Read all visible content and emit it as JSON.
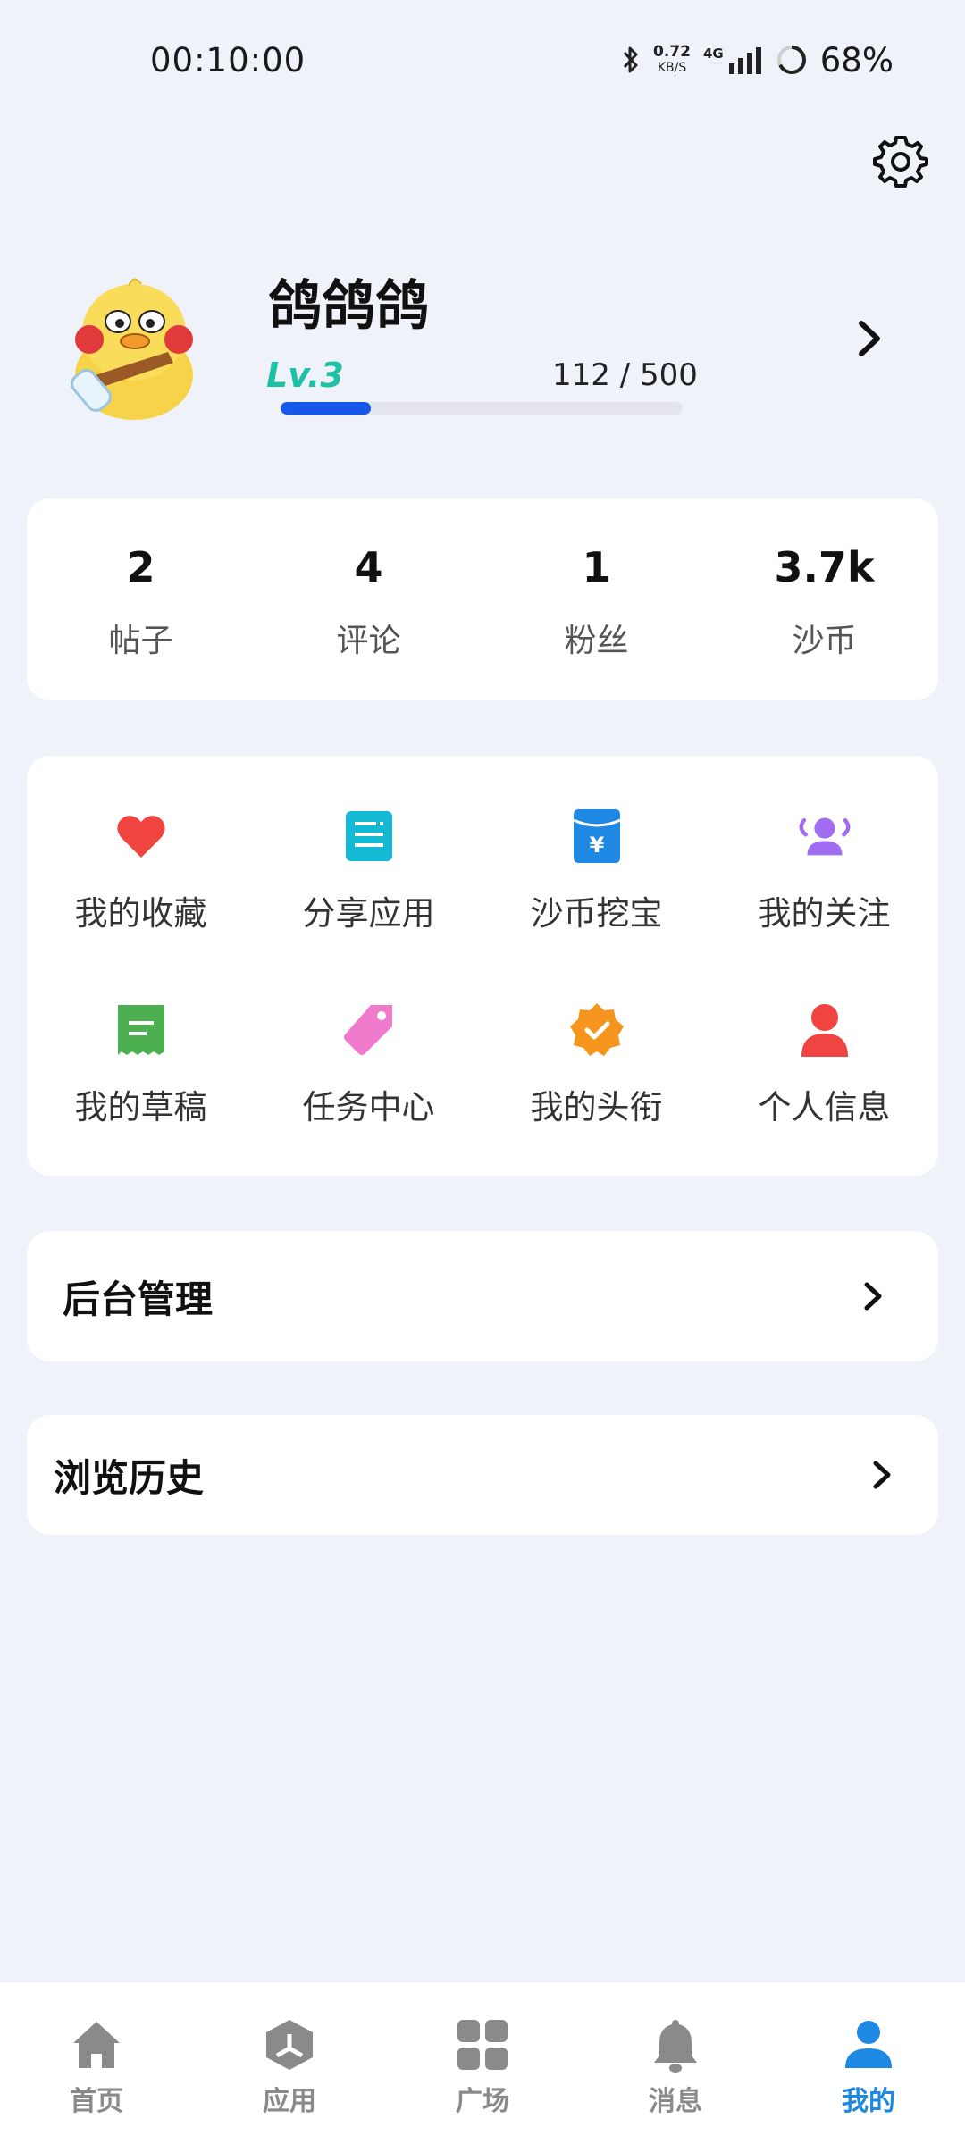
{
  "status_bar": {
    "time": "00:10:00",
    "net_speed_value": "0.72",
    "net_speed_unit": "KB/S",
    "network_type": "4G",
    "battery": "68%"
  },
  "profile": {
    "username": "鸽鸽鸽",
    "level": "Lv.3",
    "xp_text": "112 / 500",
    "xp_current": 112,
    "xp_max": 500
  },
  "stats": [
    {
      "value": "2",
      "label": "帖子"
    },
    {
      "value": "4",
      "label": "评论"
    },
    {
      "value": "1",
      "label": "粉丝"
    },
    {
      "value": "3.7k",
      "label": "沙币"
    }
  ],
  "features": [
    {
      "label": "我的收藏",
      "icon": "heart-icon",
      "color": "#ef4440"
    },
    {
      "label": "分享应用",
      "icon": "share-app-icon",
      "color": "#14b9d3"
    },
    {
      "label": "沙币挖宝",
      "icon": "treasure-coin-icon",
      "color": "#1e88e5"
    },
    {
      "label": "我的关注",
      "icon": "following-icon",
      "color": "#a06cf0"
    },
    {
      "label": "我的草稿",
      "icon": "draft-icon",
      "color": "#4caf50"
    },
    {
      "label": "任务中心",
      "icon": "task-tag-icon",
      "color": "#f07acb"
    },
    {
      "label": "我的头衔",
      "icon": "title-badge-icon",
      "color": "#f5951e"
    },
    {
      "label": "个人信息",
      "icon": "person-icon",
      "color": "#ef4440"
    }
  ],
  "menu_rows": {
    "admin": "后台管理",
    "history": "浏览历史"
  },
  "bottom_nav": [
    {
      "label": "首页",
      "icon": "home-icon",
      "active": false
    },
    {
      "label": "应用",
      "icon": "apps-box-icon",
      "active": false
    },
    {
      "label": "广场",
      "icon": "grid-square-icon",
      "active": false
    },
    {
      "label": "消息",
      "icon": "bell-icon",
      "active": false
    },
    {
      "label": "我的",
      "icon": "profile-icon",
      "active": true
    }
  ],
  "colors": {
    "accent": "#1e88e5",
    "level": "#1fc1a6",
    "xp_bar": "#1656e8",
    "background": "#eff2f8"
  }
}
